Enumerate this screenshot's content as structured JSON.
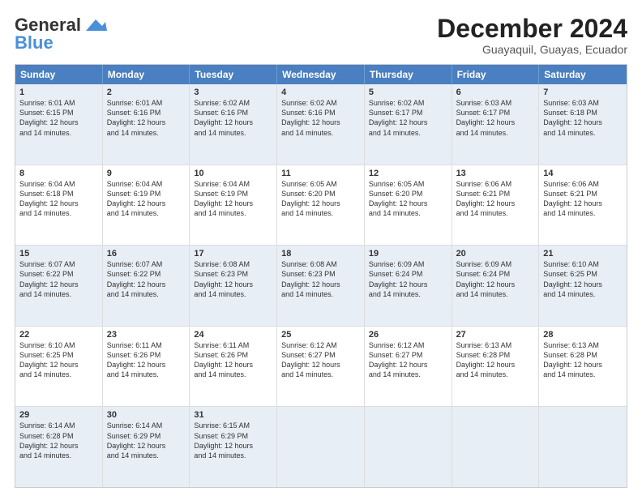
{
  "logo": {
    "line1": "General",
    "line2": "Blue"
  },
  "header": {
    "month": "December 2024",
    "location": "Guayaquil, Guayas, Ecuador"
  },
  "days": [
    "Sunday",
    "Monday",
    "Tuesday",
    "Wednesday",
    "Thursday",
    "Friday",
    "Saturday"
  ],
  "rows": [
    {
      "shade": "shaded",
      "cells": [
        {
          "day": "1",
          "lines": [
            "Sunrise: 6:01 AM",
            "Sunset: 6:15 PM",
            "Daylight: 12 hours",
            "and 14 minutes."
          ]
        },
        {
          "day": "2",
          "lines": [
            "Sunrise: 6:01 AM",
            "Sunset: 6:16 PM",
            "Daylight: 12 hours",
            "and 14 minutes."
          ]
        },
        {
          "day": "3",
          "lines": [
            "Sunrise: 6:02 AM",
            "Sunset: 6:16 PM",
            "Daylight: 12 hours",
            "and 14 minutes."
          ]
        },
        {
          "day": "4",
          "lines": [
            "Sunrise: 6:02 AM",
            "Sunset: 6:16 PM",
            "Daylight: 12 hours",
            "and 14 minutes."
          ]
        },
        {
          "day": "5",
          "lines": [
            "Sunrise: 6:02 AM",
            "Sunset: 6:17 PM",
            "Daylight: 12 hours",
            "and 14 minutes."
          ]
        },
        {
          "day": "6",
          "lines": [
            "Sunrise: 6:03 AM",
            "Sunset: 6:17 PM",
            "Daylight: 12 hours",
            "and 14 minutes."
          ]
        },
        {
          "day": "7",
          "lines": [
            "Sunrise: 6:03 AM",
            "Sunset: 6:18 PM",
            "Daylight: 12 hours",
            "and 14 minutes."
          ]
        }
      ]
    },
    {
      "shade": "white",
      "cells": [
        {
          "day": "8",
          "lines": [
            "Sunrise: 6:04 AM",
            "Sunset: 6:18 PM",
            "Daylight: 12 hours",
            "and 14 minutes."
          ]
        },
        {
          "day": "9",
          "lines": [
            "Sunrise: 6:04 AM",
            "Sunset: 6:19 PM",
            "Daylight: 12 hours",
            "and 14 minutes."
          ]
        },
        {
          "day": "10",
          "lines": [
            "Sunrise: 6:04 AM",
            "Sunset: 6:19 PM",
            "Daylight: 12 hours",
            "and 14 minutes."
          ]
        },
        {
          "day": "11",
          "lines": [
            "Sunrise: 6:05 AM",
            "Sunset: 6:20 PM",
            "Daylight: 12 hours",
            "and 14 minutes."
          ]
        },
        {
          "day": "12",
          "lines": [
            "Sunrise: 6:05 AM",
            "Sunset: 6:20 PM",
            "Daylight: 12 hours",
            "and 14 minutes."
          ]
        },
        {
          "day": "13",
          "lines": [
            "Sunrise: 6:06 AM",
            "Sunset: 6:21 PM",
            "Daylight: 12 hours",
            "and 14 minutes."
          ]
        },
        {
          "day": "14",
          "lines": [
            "Sunrise: 6:06 AM",
            "Sunset: 6:21 PM",
            "Daylight: 12 hours",
            "and 14 minutes."
          ]
        }
      ]
    },
    {
      "shade": "shaded",
      "cells": [
        {
          "day": "15",
          "lines": [
            "Sunrise: 6:07 AM",
            "Sunset: 6:22 PM",
            "Daylight: 12 hours",
            "and 14 minutes."
          ]
        },
        {
          "day": "16",
          "lines": [
            "Sunrise: 6:07 AM",
            "Sunset: 6:22 PM",
            "Daylight: 12 hours",
            "and 14 minutes."
          ]
        },
        {
          "day": "17",
          "lines": [
            "Sunrise: 6:08 AM",
            "Sunset: 6:23 PM",
            "Daylight: 12 hours",
            "and 14 minutes."
          ]
        },
        {
          "day": "18",
          "lines": [
            "Sunrise: 6:08 AM",
            "Sunset: 6:23 PM",
            "Daylight: 12 hours",
            "and 14 minutes."
          ]
        },
        {
          "day": "19",
          "lines": [
            "Sunrise: 6:09 AM",
            "Sunset: 6:24 PM",
            "Daylight: 12 hours",
            "and 14 minutes."
          ]
        },
        {
          "day": "20",
          "lines": [
            "Sunrise: 6:09 AM",
            "Sunset: 6:24 PM",
            "Daylight: 12 hours",
            "and 14 minutes."
          ]
        },
        {
          "day": "21",
          "lines": [
            "Sunrise: 6:10 AM",
            "Sunset: 6:25 PM",
            "Daylight: 12 hours",
            "and 14 minutes."
          ]
        }
      ]
    },
    {
      "shade": "white",
      "cells": [
        {
          "day": "22",
          "lines": [
            "Sunrise: 6:10 AM",
            "Sunset: 6:25 PM",
            "Daylight: 12 hours",
            "and 14 minutes."
          ]
        },
        {
          "day": "23",
          "lines": [
            "Sunrise: 6:11 AM",
            "Sunset: 6:26 PM",
            "Daylight: 12 hours",
            "and 14 minutes."
          ]
        },
        {
          "day": "24",
          "lines": [
            "Sunrise: 6:11 AM",
            "Sunset: 6:26 PM",
            "Daylight: 12 hours",
            "and 14 minutes."
          ]
        },
        {
          "day": "25",
          "lines": [
            "Sunrise: 6:12 AM",
            "Sunset: 6:27 PM",
            "Daylight: 12 hours",
            "and 14 minutes."
          ]
        },
        {
          "day": "26",
          "lines": [
            "Sunrise: 6:12 AM",
            "Sunset: 6:27 PM",
            "Daylight: 12 hours",
            "and 14 minutes."
          ]
        },
        {
          "day": "27",
          "lines": [
            "Sunrise: 6:13 AM",
            "Sunset: 6:28 PM",
            "Daylight: 12 hours",
            "and 14 minutes."
          ]
        },
        {
          "day": "28",
          "lines": [
            "Sunrise: 6:13 AM",
            "Sunset: 6:28 PM",
            "Daylight: 12 hours",
            "and 14 minutes."
          ]
        }
      ]
    },
    {
      "shade": "shaded",
      "cells": [
        {
          "day": "29",
          "lines": [
            "Sunrise: 6:14 AM",
            "Sunset: 6:28 PM",
            "Daylight: 12 hours",
            "and 14 minutes."
          ]
        },
        {
          "day": "30",
          "lines": [
            "Sunrise: 6:14 AM",
            "Sunset: 6:29 PM",
            "Daylight: 12 hours",
            "and 14 minutes."
          ]
        },
        {
          "day": "31",
          "lines": [
            "Sunrise: 6:15 AM",
            "Sunset: 6:29 PM",
            "Daylight: 12 hours",
            "and 14 minutes."
          ]
        },
        {
          "day": "",
          "lines": []
        },
        {
          "day": "",
          "lines": []
        },
        {
          "day": "",
          "lines": []
        },
        {
          "day": "",
          "lines": []
        }
      ]
    }
  ]
}
